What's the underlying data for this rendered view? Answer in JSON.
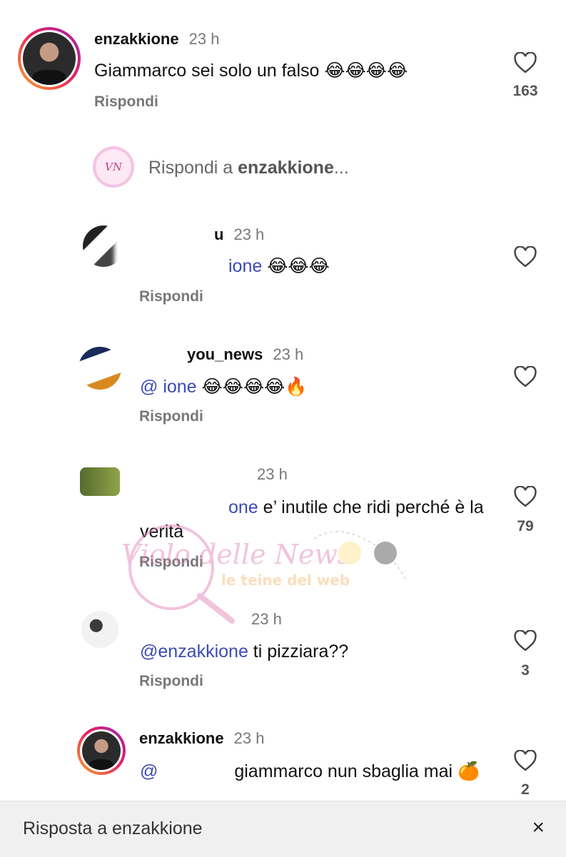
{
  "comments": [
    {
      "username": "enzakkione",
      "time": "23 h",
      "mention": "",
      "text": "Giammarco sei solo un falso 😂😂😂😂",
      "reply_label": "Rispondi",
      "likes": "163"
    },
    {
      "username": "u",
      "time": "23 h",
      "mention": "ione",
      "text": " 😂😂😂",
      "reply_label": "Rispondi",
      "likes": ""
    },
    {
      "username": "you_news",
      "time": "23 h",
      "mention": "@ ione",
      "text": " 😂😂😂😂🔥",
      "reply_label": "Rispondi",
      "likes": ""
    },
    {
      "username": "",
      "time": "23 h",
      "mention": "one",
      "text": " e’ inutile che ridi perché è la verità",
      "reply_label": "Rispondi",
      "likes": "79"
    },
    {
      "username": "",
      "time": "23 h",
      "mention": "@enzakkione",
      "text": " ti pizziara??",
      "reply_label": "Rispondi",
      "likes": "3"
    },
    {
      "username": "enzakkione",
      "time": "23 h",
      "mention": "@",
      "text": " giammarco nun sbaglia mai 🍊",
      "reply_label": "",
      "likes": "2"
    }
  ],
  "reply_prompt": {
    "prefix": "Rispondi a ",
    "username": "enzakkione",
    "suffix": "..."
  },
  "watermark": {
    "brand": "Violo delle News",
    "tagline": "le teine del web"
  },
  "bottom_bar": {
    "label": "Risposta a enzakkione",
    "close_icon": "×"
  },
  "colors": {
    "mention": "#3b4bb5",
    "secondary_text": "#777777",
    "bottom_bar": "#f0f0f1"
  }
}
